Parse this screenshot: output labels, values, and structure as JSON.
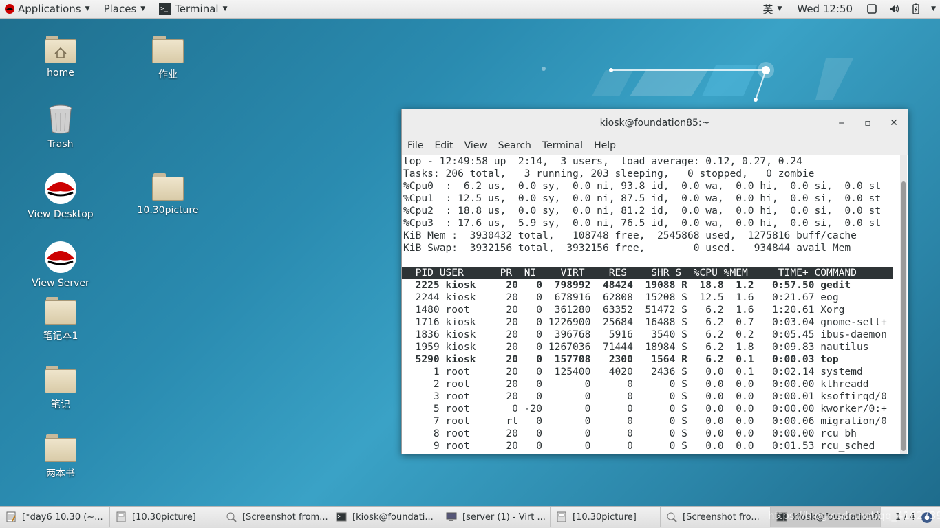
{
  "topbar": {
    "applications": "Applications",
    "places": "Places",
    "terminal": "Terminal",
    "input_method": "英",
    "clock": "Wed 12:50"
  },
  "desktop": {
    "icons": [
      {
        "label": "home"
      },
      {
        "label": "作业"
      },
      {
        "label": "Trash"
      },
      {
        "label": "View Desktop"
      },
      {
        "label": "10.30picture"
      },
      {
        "label": "View Server"
      },
      {
        "label": "笔记本1"
      },
      {
        "label": "笔记"
      },
      {
        "label": "两本书"
      }
    ]
  },
  "terminal": {
    "title": "kiosk@foundation85:~",
    "menu": [
      "File",
      "Edit",
      "View",
      "Search",
      "Terminal",
      "Help"
    ],
    "summary": [
      "top - 12:49:58 up  2:14,  3 users,  load average: 0.12, 0.27, 0.24",
      "Tasks: 206 total,   3 running, 203 sleeping,   0 stopped,   0 zombie",
      "%Cpu0  :  6.2 us,  0.0 sy,  0.0 ni, 93.8 id,  0.0 wa,  0.0 hi,  0.0 si,  0.0 st",
      "%Cpu1  : 12.5 us,  0.0 sy,  0.0 ni, 87.5 id,  0.0 wa,  0.0 hi,  0.0 si,  0.0 st",
      "%Cpu2  : 18.8 us,  0.0 sy,  0.0 ni, 81.2 id,  0.0 wa,  0.0 hi,  0.0 si,  0.0 st",
      "%Cpu3  : 17.6 us,  5.9 sy,  0.0 ni, 76.5 id,  0.0 wa,  0.0 hi,  0.0 si,  0.0 st",
      "KiB Mem :  3930432 total,   108748 free,  2545868 used,  1275816 buff/cache",
      "KiB Swap:  3932156 total,  3932156 free,        0 used.   934844 avail Mem"
    ],
    "header": "  PID USER      PR  NI    VIRT    RES    SHR S  %CPU %MEM     TIME+ COMMAND",
    "processes": [
      "  2225 kiosk     20   0  798992  48424  19088 R  18.8  1.2   0:57.50 gedit",
      "  2244 kiosk     20   0  678916  62808  15208 S  12.5  1.6   0:21.67 eog",
      "  1480 root      20   0  361280  63352  51472 S   6.2  1.6   1:20.61 Xorg",
      "  1716 kiosk     20   0 1226900  25684  16488 S   6.2  0.7   0:03.04 gnome-sett+",
      "  1836 kiosk     20   0  396768   5916   3540 S   6.2  0.2   0:05.45 ibus-daemon",
      "  1959 kiosk     20   0 1267036  71444  18984 S   6.2  1.8   0:09.83 nautilus",
      "  5290 kiosk     20   0  157708   2300   1564 R   6.2  0.1   0:00.03 top",
      "     1 root      20   0  125400   4020   2436 S   0.0  0.1   0:02.14 systemd",
      "     2 root      20   0       0      0      0 S   0.0  0.0   0:00.00 kthreadd",
      "     3 root      20   0       0      0      0 S   0.0  0.0   0:00.01 ksoftirqd/0",
      "     5 root       0 -20       0      0      0 S   0.0  0.0   0:00.00 kworker/0:+",
      "     7 root      rt   0       0      0      0 S   0.0  0.0   0:00.06 migration/0",
      "     8 root      20   0       0      0      0 S   0.0  0.0   0:00.00 rcu_bh",
      "     9 root      20   0       0      0      0 S   0.0  0.0   0:01.53 rcu_sched"
    ]
  },
  "taskbar": {
    "tasks": [
      {
        "label": "[*day6 10.30 (~..."
      },
      {
        "label": "[10.30picture]"
      },
      {
        "label": "[Screenshot from..."
      },
      {
        "label": "[kiosk@foundati..."
      },
      {
        "label": "[server (1) - Virt ..."
      },
      {
        "label": "[10.30picture]"
      },
      {
        "label": "[Screenshot fro..."
      },
      {
        "label": "kiosk@foundation85:~"
      }
    ],
    "pager": "1 / 4",
    "watermark": "https://blog.csdn.net/qq_41627390"
  }
}
